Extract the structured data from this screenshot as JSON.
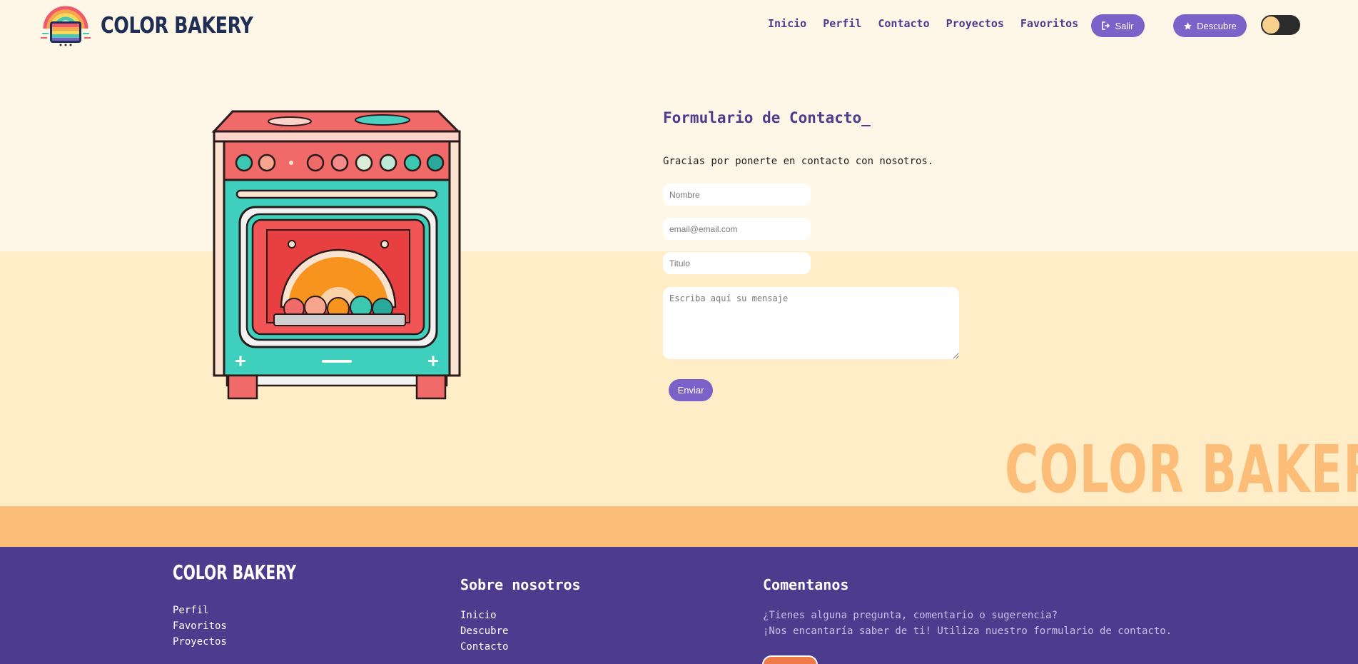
{
  "header": {
    "brand": "COLOR BAKERY",
    "nav": [
      "Inicio",
      "Perfil",
      "Contacto",
      "Proyectos",
      "Favoritos"
    ],
    "salir_label": "Salir",
    "descubre_label": "Descubre"
  },
  "form": {
    "title": "Formulario de Contacto_",
    "subtitle": "Gracias por ponerte en contacto con nosotros.",
    "nombre_placeholder": "Nombre",
    "email_placeholder": "email@email.com",
    "titulo_placeholder": "Titulo",
    "mensaje_placeholder": "Escriba aquí su mensaje",
    "submit_label": "Enviar"
  },
  "watermark": "COLOR BAKERY",
  "footer": {
    "brand": "COLOR BAKERY",
    "links": [
      "Perfil",
      "Favoritos",
      "Proyectos"
    ],
    "about_title": "Sobre nosotros",
    "about_links": [
      "Inicio",
      "Descubre",
      "Contacto"
    ],
    "comment_title": "Comentanos",
    "comment_line1": "¿Tienes alguna pregunta, comentario o sugerencia?",
    "comment_line2": "¡Nos encantaría saber de ti! Utiliza nuestro formulario de contacto."
  },
  "colors": {
    "brand_purple": "#4d3c8e",
    "button_purple": "#7b62c9",
    "cream": "#fef6e7",
    "peach": "#ffedc8",
    "orange": "#fbbd78"
  }
}
